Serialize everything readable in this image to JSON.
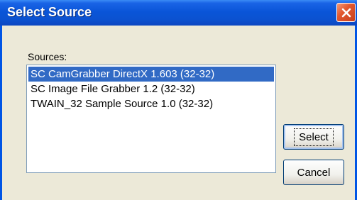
{
  "window": {
    "title": "Select Source",
    "colors": {
      "titlebar": "#0a55d8",
      "close": "#e2582f",
      "selection": "#316ac5",
      "dialog_bg": "#ece9d8"
    }
  },
  "sources_label": "Sources:",
  "sources": [
    {
      "label": "SC CamGrabber DirectX 1.603 (32-32)",
      "selected": true
    },
    {
      "label": "SC Image File Grabber 1.2 (32-32)",
      "selected": false
    },
    {
      "label": "TWAIN_32 Sample Source 1.0 (32-32)",
      "selected": false
    }
  ],
  "buttons": {
    "select": "Select",
    "cancel": "Cancel"
  },
  "icons": {
    "close": "close-icon"
  }
}
